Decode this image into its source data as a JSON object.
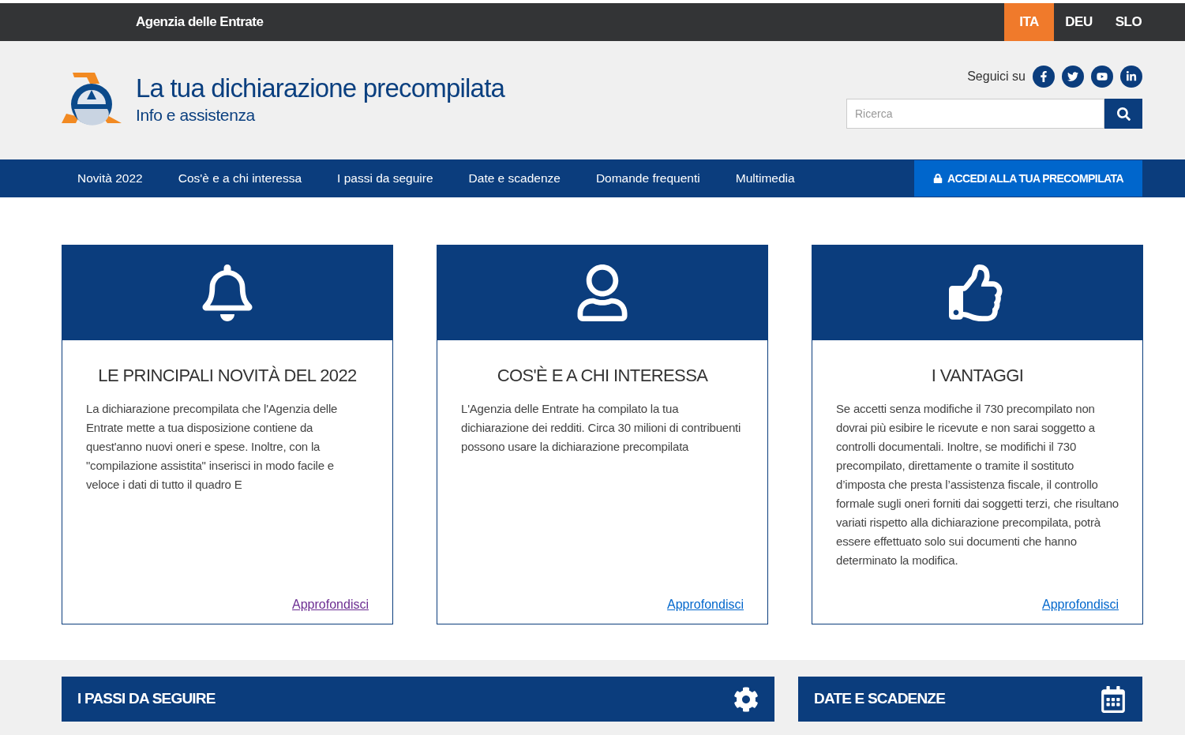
{
  "top_bar": {
    "site_name": "Agenzia delle Entrate",
    "languages": [
      {
        "label": "ITA",
        "selected": true
      },
      {
        "label": "DEU",
        "selected": false
      },
      {
        "label": "SLO",
        "selected": false
      }
    ]
  },
  "header": {
    "title": "La tua dichiarazione precompilata",
    "subtitle": "Info e assistenza",
    "follow_label": "Seguici su",
    "search": {
      "placeholder": "Ricerca"
    }
  },
  "nav": {
    "items": [
      "Novità 2022",
      "Cos'è e a chi interessa",
      "I passi da seguire",
      "Date e scadenze",
      "Domande frequenti",
      "Multimedia"
    ],
    "login_button": "ACCEDI ALLA TUA PRECOMPILATA"
  },
  "cards": [
    {
      "title": "LE PRINCIPALI NOVITÀ DEL 2022",
      "text": "La dichiarazione precompilata che l'Agenzia delle Entrate mette a tua disposizione contiene da quest'anno nuovi oneri e spese. Inoltre, con la \"compilazione assistita\" inserisci in modo facile e veloce i dati di tutto il quadro E",
      "link": "Approfondisci",
      "visited": true
    },
    {
      "title": "COS'È E A CHI INTERESSA",
      "text": "L'Agenzia delle Entrate ha compilato la tua dichiarazione dei redditi. Circa 30 milioni di contribuenti possono usare la dichiarazione precompilata",
      "link": "Approfondisci",
      "visited": false
    },
    {
      "title": "I VANTAGGI",
      "text": "Se accetti senza modifiche il 730 precompilato non dovrai più esibire le ricevute e non sarai soggetto a controlli documentali. Inoltre, se modifichi il 730 precompilato, direttamente o tramite il sostituto d’imposta che presta l’assistenza fiscale, il controllo formale sugli oneri forniti dai soggetti terzi, che risultano variati rispetto alla dichiarazione precompilata, potrà essere effettuato solo sui documenti che hanno determinato la modifica.",
      "link": "Approfondisci",
      "visited": false
    }
  ],
  "sections": [
    "I PASSI DA SEGUIRE",
    "DATE E SCADENZE"
  ]
}
